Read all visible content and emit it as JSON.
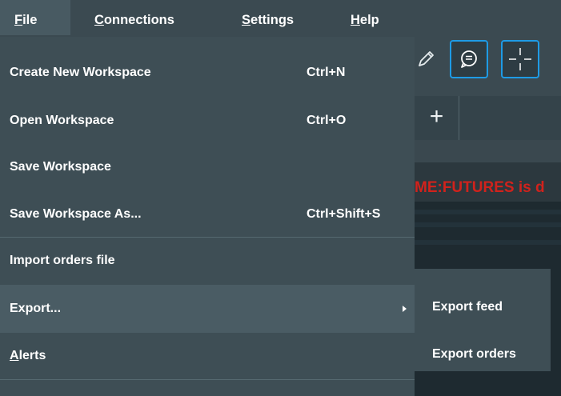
{
  "menubar": {
    "file_u": "F",
    "file_rest": "ile",
    "connections_u": "C",
    "connections_rest": "onnections",
    "settings_u": "S",
    "settings_rest": "ettings",
    "help_u": "H",
    "help_rest": "elp"
  },
  "background": {
    "ticker_text": "ME:FUTURES is d",
    "plus_tab": "+",
    "ticker_color": "#d1221c",
    "accent_color": "#1e9be6"
  },
  "file_menu": {
    "items": [
      {
        "label": "Create New Workspace",
        "shortcut": "Ctrl+N"
      },
      {
        "label": "Open Workspace",
        "shortcut": "Ctrl+O"
      },
      {
        "label": "Save Workspace",
        "shortcut": ""
      },
      {
        "label": "Save Workspace As...",
        "shortcut": "Ctrl+Shift+S"
      },
      {
        "label": "Import orders file",
        "shortcut": ""
      },
      {
        "label": "Export...",
        "shortcut": "",
        "submenu": true
      },
      {
        "label_u": "A",
        "label_rest": "lerts",
        "shortcut": ""
      }
    ]
  },
  "export_submenu": {
    "items": [
      {
        "label": "Export feed"
      },
      {
        "label": "Export orders"
      }
    ]
  },
  "icons": [
    "pencil-icon",
    "chat-bubble-icon",
    "crosshair-icon",
    "submenu-arrow-icon"
  ]
}
